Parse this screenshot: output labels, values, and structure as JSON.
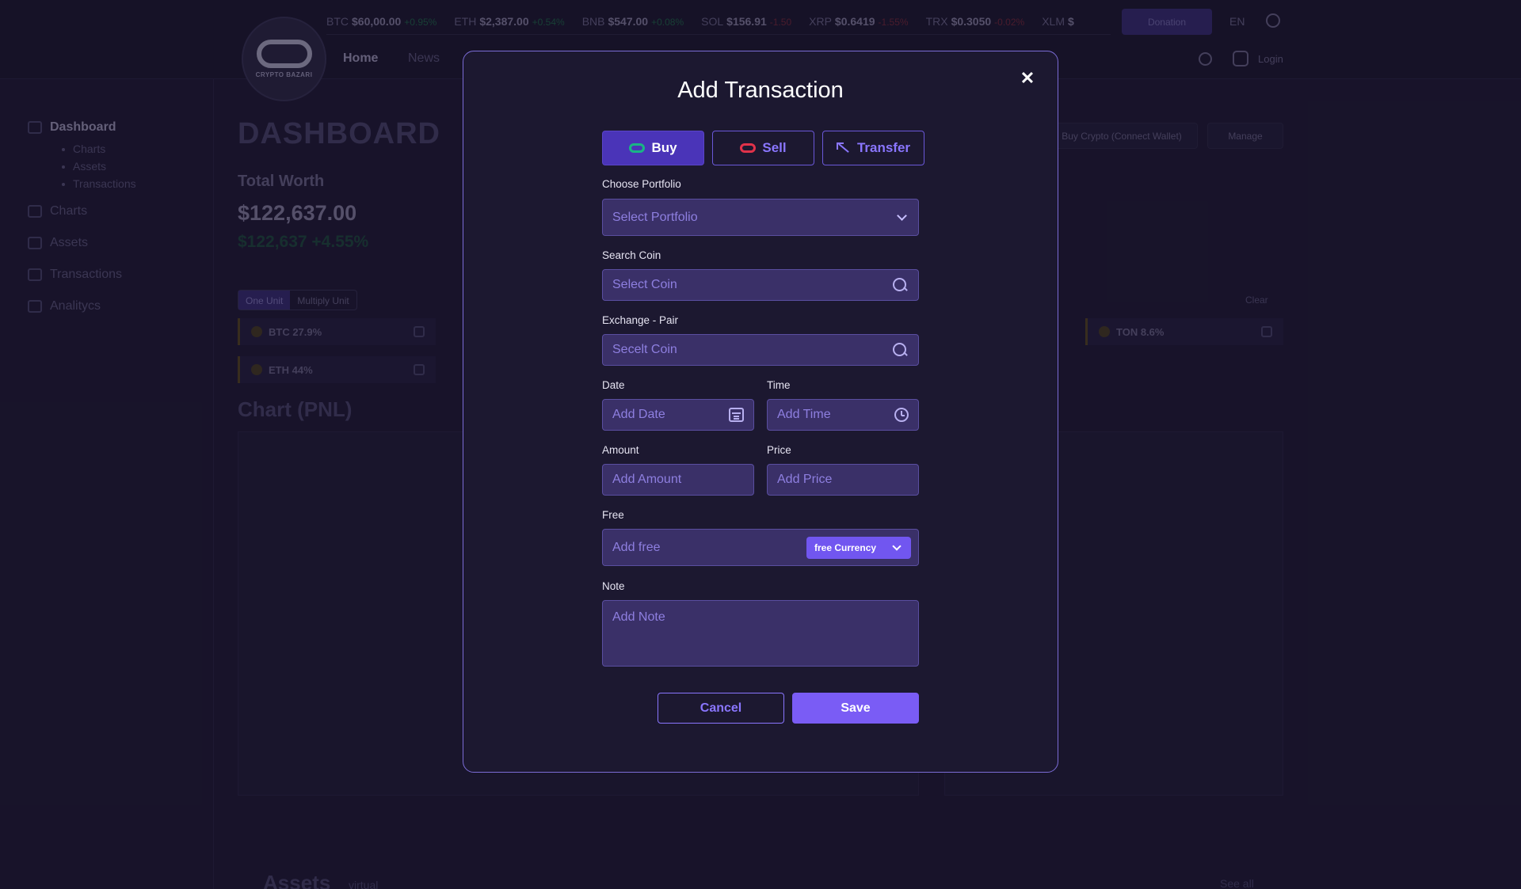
{
  "background": {
    "logo_text": "CRYPTO BAZARI",
    "ticker": [
      {
        "symbol": "BTC",
        "price": "$60,00.00",
        "change": "+0.95%",
        "dir": "up"
      },
      {
        "symbol": "ETH",
        "price": "$2,387.00",
        "change": "+0.54%",
        "dir": "up"
      },
      {
        "symbol": "BNB",
        "price": "$547.00",
        "change": "+0.08%",
        "dir": "up"
      },
      {
        "symbol": "SOL",
        "price": "$156.91",
        "change": "-1.50",
        "dir": "down"
      },
      {
        "symbol": "XRP",
        "price": "$0.6419",
        "change": "-1.55%",
        "dir": "down"
      },
      {
        "symbol": "TRX",
        "price": "$0.3050",
        "change": "-0.02%",
        "dir": "down"
      },
      {
        "symbol": "XLM",
        "price": "$",
        "change": "",
        "dir": "up"
      }
    ],
    "donation_label": "Donation",
    "lang": "EN",
    "nav": {
      "home": "Home",
      "news": "News"
    },
    "login": "Login",
    "sidebar": {
      "dashboard": "Dashboard",
      "sub_items": [
        "Charts",
        "Assets",
        "Transactions"
      ],
      "items": [
        "Charts",
        "Assets",
        "Transactions",
        "Analitycs"
      ]
    },
    "dashboard_title": "DASHBOARD",
    "total_worth_label": "Total Worth",
    "total_worth_value": "$122,637.00",
    "total_worth_change": "$122,637 +4.55%",
    "unit_toggle": {
      "one": "One Unit",
      "multiply": "Multiply Unit"
    },
    "coin_chips": [
      {
        "label": "BTC  27.9%"
      },
      {
        "label": "ETH  44%"
      },
      {
        "label": "TON  8.6%"
      }
    ],
    "chart_title": "Chart (PNL)",
    "buy_crypto_label": "Buy Crypto (Connect Wallet)",
    "manage_label": "Manage",
    "clear_label": "Clear",
    "assets_title": "Assets",
    "assets_sub": "virtual",
    "see_all": "See all"
  },
  "modal": {
    "title": "Add Transaction",
    "close_symbol": "✕",
    "type_buttons": {
      "buy": "Buy",
      "sell": "Sell",
      "transfer": "Transfer"
    },
    "portfolio": {
      "label": "Choose Portfolio",
      "placeholder": "Select Portfolio"
    },
    "search_coin": {
      "label": "Search Coin",
      "placeholder": "Select Coin"
    },
    "exchange_pair": {
      "label": "Exchange - Pair",
      "placeholder": "Secelt Coin"
    },
    "date": {
      "label": "Date",
      "placeholder": "Add Date"
    },
    "time": {
      "label": "Time",
      "placeholder": "Add Time"
    },
    "amount": {
      "label": "Amount",
      "placeholder": "Add Amount"
    },
    "price": {
      "label": "Price",
      "placeholder": "Add Price"
    },
    "free": {
      "label": "Free",
      "placeholder": "Add free",
      "currency_label": "free Currency"
    },
    "note": {
      "label": "Note",
      "placeholder": "Add Note"
    },
    "cancel_label": "Cancel",
    "save_label": "Save"
  },
  "colors": {
    "accent": "#7a5cf5",
    "buy_icon": "#19b585",
    "sell_icon": "#e0324a",
    "modal_border": "#7b6cd6",
    "field_bg": "#3a3068"
  }
}
